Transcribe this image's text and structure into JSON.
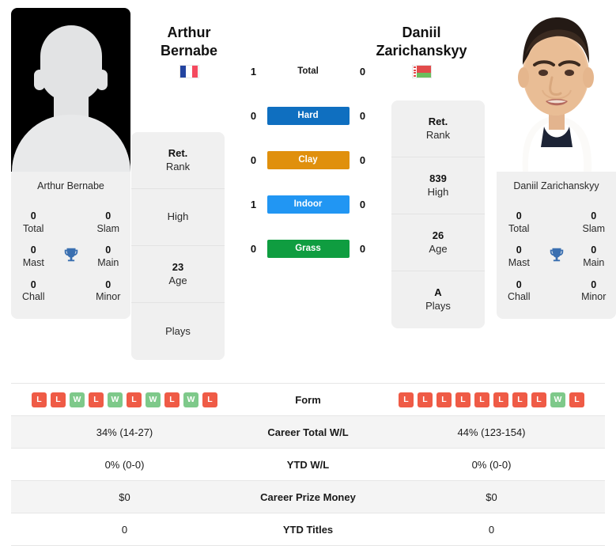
{
  "players": {
    "left": {
      "first_name": "Arthur",
      "last_name": "Bernabe",
      "full_name": "Arthur Bernabe",
      "flag": "fr-flag-icon",
      "photo": "placeholder-avatar",
      "titles": {
        "total_value": "0",
        "total_label": "Total",
        "slam_value": "0",
        "slam_label": "Slam",
        "mast_value": "0",
        "mast_label": "Mast",
        "main_value": "0",
        "main_label": "Main",
        "chall_value": "0",
        "chall_label": "Chall",
        "minor_value": "0",
        "minor_label": "Minor",
        "trophy_icon": "trophy-icon"
      },
      "info": [
        {
          "value": "Ret.",
          "label": "Rank"
        },
        {
          "value": "",
          "label": "High"
        },
        {
          "value": "23",
          "label": "Age"
        },
        {
          "value": "",
          "label": "Plays"
        }
      ],
      "form": [
        "L",
        "L",
        "W",
        "L",
        "W",
        "L",
        "W",
        "L",
        "W",
        "L"
      ],
      "career_total_wl": "34% (14-27)",
      "ytd_wl": "0% (0-0)",
      "career_prize_money": "$0",
      "ytd_titles": "0"
    },
    "right": {
      "first_name": "Daniil",
      "last_name": "Zarichanskyy",
      "full_name": "Daniil Zarichanskyy",
      "flag": "by-flag-icon",
      "photo": "player-portrait",
      "titles": {
        "total_value": "0",
        "total_label": "Total",
        "slam_value": "0",
        "slam_label": "Slam",
        "mast_value": "0",
        "mast_label": "Mast",
        "main_value": "0",
        "main_label": "Main",
        "chall_value": "0",
        "chall_label": "Chall",
        "minor_value": "0",
        "minor_label": "Minor",
        "trophy_icon": "trophy-icon"
      },
      "info": [
        {
          "value": "Ret.",
          "label": "Rank"
        },
        {
          "value": "839",
          "label": "High"
        },
        {
          "value": "26",
          "label": "Age"
        },
        {
          "value": "A",
          "label": "Plays"
        }
      ],
      "form": [
        "L",
        "L",
        "L",
        "L",
        "L",
        "L",
        "L",
        "L",
        "W",
        "L"
      ],
      "career_total_wl": "44% (123-154)",
      "ytd_wl": "0% (0-0)",
      "career_prize_money": "$0",
      "ytd_titles": "0"
    }
  },
  "h2h": [
    {
      "label": "Total",
      "left": "1",
      "right": "0",
      "color": "none",
      "style": "plain"
    },
    {
      "label": "Hard",
      "left": "0",
      "right": "0",
      "color": "#0f6fc0",
      "style": "bar"
    },
    {
      "label": "Clay",
      "left": "0",
      "right": "0",
      "color": "#e0900d",
      "style": "bar"
    },
    {
      "label": "Indoor",
      "left": "1",
      "right": "0",
      "color": "#2196f3",
      "style": "bar"
    },
    {
      "label": "Grass",
      "left": "0",
      "right": "0",
      "color": "#0f9d40",
      "style": "bar"
    }
  ],
  "stats_rows": [
    {
      "label": "Form",
      "left": "",
      "right": "",
      "type": "form"
    },
    {
      "label": "Career Total W/L",
      "left": "34% (14-27)",
      "right": "44% (123-154)",
      "type": "text"
    },
    {
      "label": "YTD W/L",
      "left": "0% (0-0)",
      "right": "0% (0-0)",
      "type": "text"
    },
    {
      "label": "Career Prize Money",
      "left": "$0",
      "right": "$0",
      "type": "text"
    },
    {
      "label": "YTD Titles",
      "left": "0",
      "right": "0",
      "type": "text"
    }
  ],
  "colors": {
    "hard": "#0f6fc0",
    "clay": "#e0900d",
    "indoor": "#2196f3",
    "grass": "#0f9d40",
    "win_badge": "#7ec98a",
    "loss_badge": "#ef5b46",
    "trophy": "#3a6fb0",
    "card_bg": "#f0f0f0"
  }
}
